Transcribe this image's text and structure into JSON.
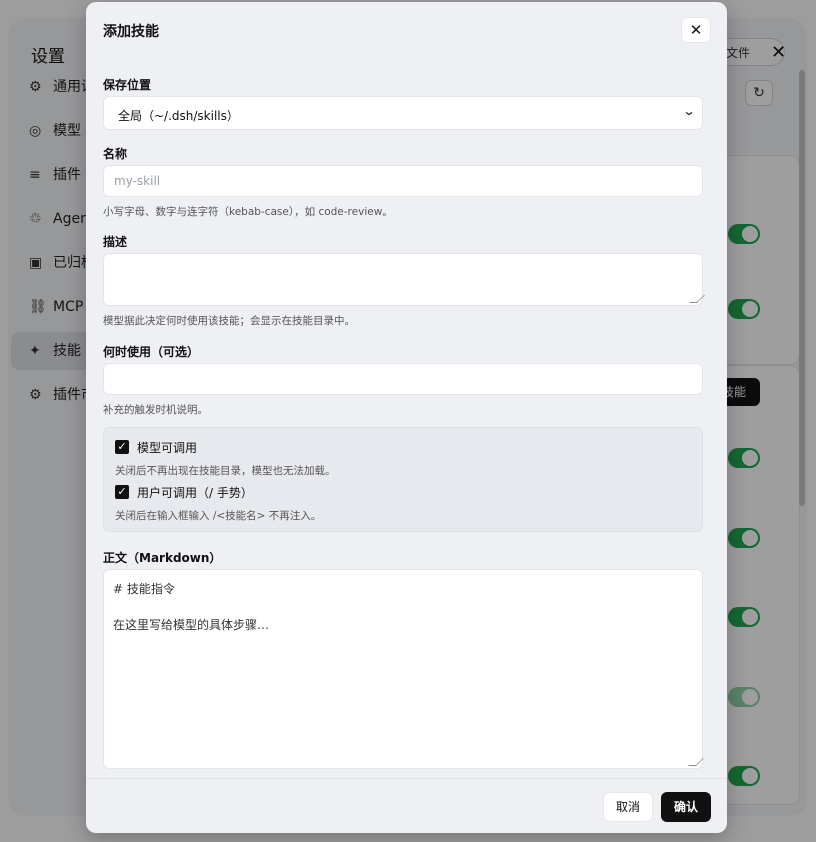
{
  "background": {
    "title": "设置",
    "close_glyph": "✕",
    "file_button": "文件",
    "refresh_glyph": "↻",
    "skill_button": "技能",
    "nav": [
      {
        "icon": "⚙",
        "label": "通用设置"
      },
      {
        "icon": "◎",
        "label": "模型"
      },
      {
        "icon": "≡",
        "label": "插件"
      },
      {
        "icon": "♲",
        "label": "Agent"
      },
      {
        "icon": "▣",
        "label": "已归档"
      },
      {
        "icon": "⛓",
        "label": "MCP"
      },
      {
        "icon": "✦",
        "label": "技能"
      },
      {
        "icon": "⚙",
        "label": "插件市场"
      }
    ]
  },
  "modal": {
    "title": "添加技能",
    "close_glyph": "✕",
    "save_location": {
      "label": "保存位置",
      "value": "全局（~/.dsh/skills）"
    },
    "name": {
      "label": "名称",
      "placeholder": "my-skill",
      "hint": "小写字母、数字与连字符（kebab-case），如 code-review。"
    },
    "description": {
      "label": "描述",
      "hint": "模型据此决定何时使用该技能；会显示在技能目录中。"
    },
    "when_to_use": {
      "label": "何时使用（可选）",
      "hint": "补充的触发时机说明。"
    },
    "model_invocable": {
      "label": "模型可调用",
      "hint": "关闭后不再出现在技能目录，模型也无法加载。",
      "checked": true
    },
    "user_invocable": {
      "label": "用户可调用（/ 手势）",
      "hint": "关闭后在输入框输入 /<技能名> 不再注入。",
      "checked": true
    },
    "body": {
      "label": "正文（Markdown）",
      "line1": "# 技能指令",
      "line2": "在这里写给模型的具体步骤…"
    },
    "cancel_label": "取消",
    "confirm_label": "确认"
  }
}
